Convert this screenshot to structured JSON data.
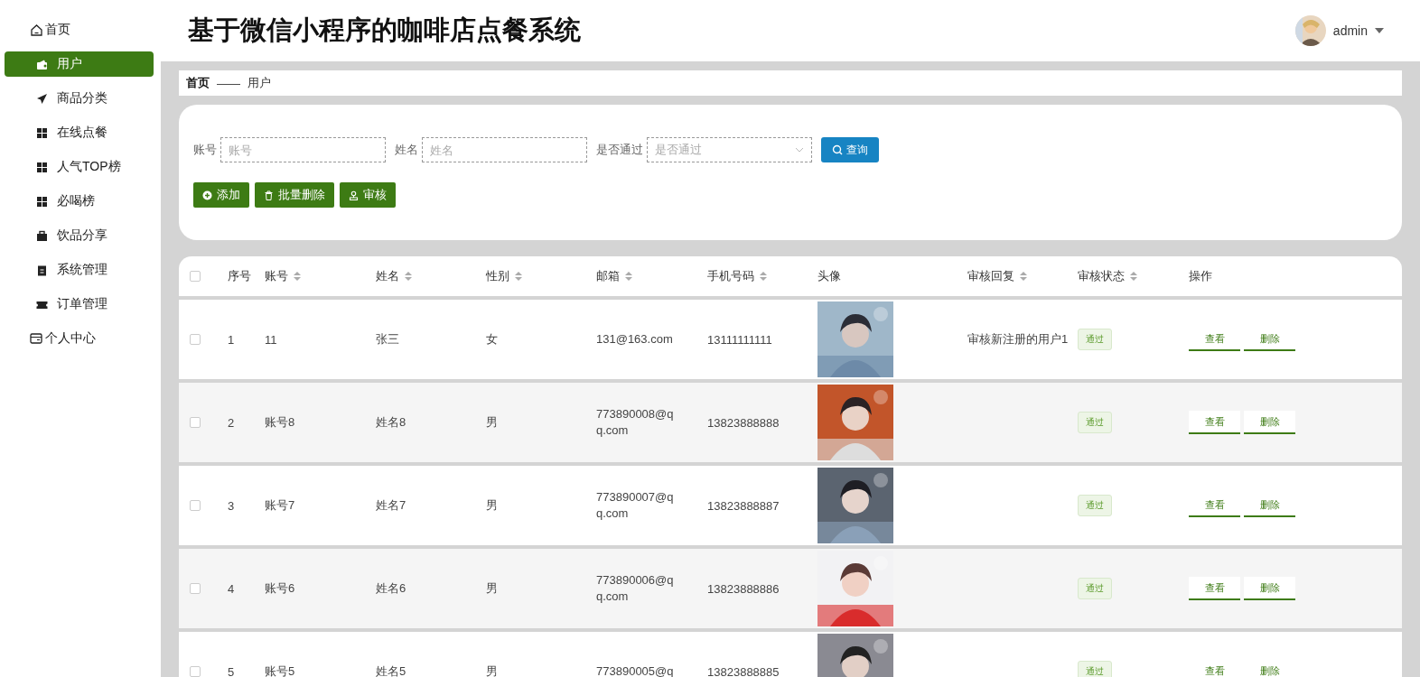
{
  "header": {
    "title": "基于微信小程序的咖啡店点餐系统",
    "user": {
      "name": "admin"
    }
  },
  "sidebar": {
    "items": [
      {
        "label": "首页",
        "kind": "top",
        "selected": false
      },
      {
        "label": "用户",
        "kind": "menu",
        "selected": true
      },
      {
        "label": "商品分类",
        "kind": "menu",
        "selected": false
      },
      {
        "label": "在线点餐",
        "kind": "menu",
        "selected": false
      },
      {
        "label": "人气TOP榜",
        "kind": "menu",
        "selected": false
      },
      {
        "label": "必喝榜",
        "kind": "menu",
        "selected": false
      },
      {
        "label": "饮品分享",
        "kind": "menu",
        "selected": false
      },
      {
        "label": "系统管理",
        "kind": "menu",
        "selected": false
      },
      {
        "label": "订单管理",
        "kind": "menu",
        "selected": false
      },
      {
        "label": "个人中心",
        "kind": "top",
        "selected": false
      }
    ]
  },
  "breadcrumb": {
    "items": [
      "首页",
      "用户"
    ],
    "separator": "——"
  },
  "search": {
    "fields": [
      {
        "label": "账号",
        "placeholder": "账号",
        "kind": "text"
      },
      {
        "label": "姓名",
        "placeholder": "姓名",
        "kind": "text"
      },
      {
        "label": "是否通过",
        "placeholder": "是否通过",
        "kind": "select"
      }
    ],
    "query_button": "查询",
    "actions": [
      {
        "label": "添加",
        "kind": "add"
      },
      {
        "label": "批量删除",
        "kind": "delete"
      },
      {
        "label": "审核",
        "kind": "review"
      }
    ]
  },
  "table": {
    "all_checked": false,
    "columns": [
      {
        "label": "序号",
        "sortable": false
      },
      {
        "label": "账号",
        "sortable": true
      },
      {
        "label": "姓名",
        "sortable": true
      },
      {
        "label": "性别",
        "sortable": true
      },
      {
        "label": "邮箱",
        "sortable": true
      },
      {
        "label": "手机号码",
        "sortable": true
      },
      {
        "label": "头像",
        "sortable": false
      },
      {
        "label": "审核回复",
        "sortable": true
      },
      {
        "label": "审核状态",
        "sortable": true
      },
      {
        "label": "操作",
        "sortable": false
      }
    ],
    "rows": [
      {
        "checked": false,
        "no": "1",
        "account": "11",
        "name": "张三",
        "gender": "女",
        "email": "131@163.com",
        "phone": "13111111111",
        "avatar": {
          "kind": "picture"
        },
        "reply": "审核新注册的用户1",
        "status": "通过",
        "actions": [
          "查看",
          "删除"
        ]
      },
      {
        "checked": false,
        "no": "2",
        "account": "账号8",
        "name": "姓名8",
        "gender": "男",
        "email": "773890008@qq.com",
        "phone": "13823888888",
        "avatar": {
          "kind": "picture"
        },
        "status": "通过",
        "actions": [
          "查看",
          "删除"
        ]
      },
      {
        "checked": false,
        "no": "3",
        "account": "账号7",
        "name": "姓名7",
        "gender": "男",
        "email": "773890007@qq.com",
        "phone": "13823888887",
        "avatar": {
          "kind": "picture"
        },
        "status": "通过",
        "actions": [
          "查看",
          "删除"
        ]
      },
      {
        "checked": false,
        "no": "4",
        "account": "账号6",
        "name": "姓名6",
        "gender": "男",
        "email": "773890006@qq.com",
        "phone": "13823888886",
        "avatar": {
          "kind": "picture"
        },
        "status": "通过",
        "actions": [
          "查看",
          "删除"
        ]
      },
      {
        "checked": false,
        "no": "5",
        "account": "账号5",
        "name": "姓名5",
        "gender": "男",
        "email": "773890005@q",
        "phone": "13823888885",
        "avatar": {
          "kind": "picture"
        },
        "status": "通过",
        "actions": [
          "查看",
          "删除"
        ]
      }
    ]
  }
}
